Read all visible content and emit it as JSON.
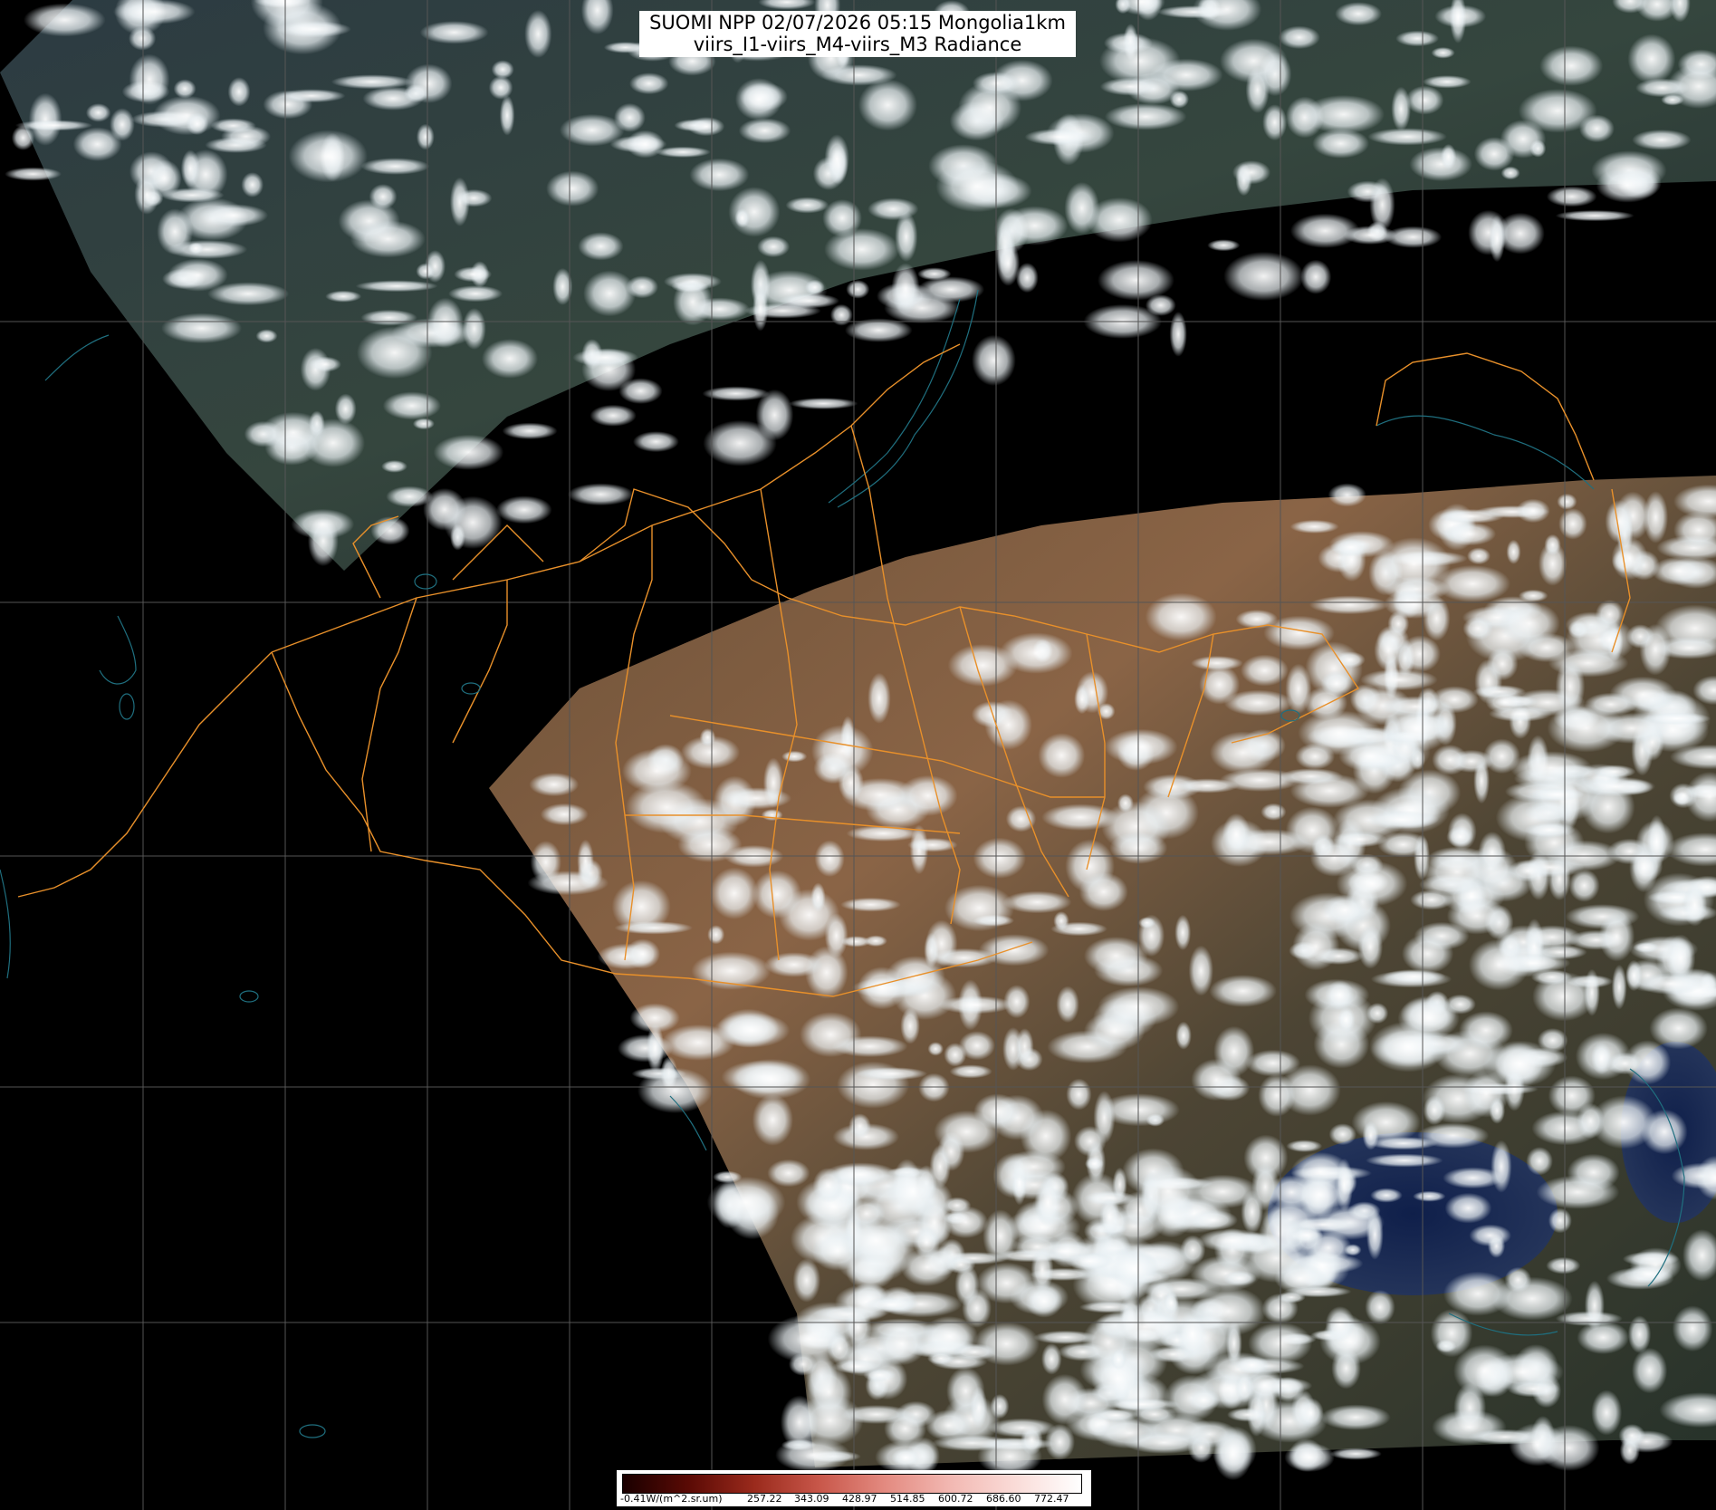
{
  "title": {
    "line1": "SUOMI NPP 02/07/2026 05:15 Mongolia1km",
    "line2": "viirs_I1-viirs_M4-viirs_M3 Radiance"
  },
  "colorbar": {
    "labels": [
      "-0.41W/(m^2.sr.um)",
      "257.22",
      "343.09",
      "428.97",
      "514.85",
      "600.72",
      "686.60",
      "772.47"
    ],
    "colors": [
      "#1a0000",
      "#5a0a05",
      "#9a2a1c",
      "#c8574a",
      "#e38a80",
      "#f2b8b2",
      "#fadcd8",
      "#ffffff"
    ]
  },
  "colors": {
    "background": "#000000",
    "grid": "#555555",
    "border": "#e8902a",
    "water": "#1f6f7f",
    "cloud": "#f4f8fb",
    "land_dark": "#233028",
    "desert": "#8a6446",
    "sea": "#1a2a4a"
  },
  "icons": [
    "colorbar-icon",
    "graticule-icon",
    "coastline-icon"
  ]
}
